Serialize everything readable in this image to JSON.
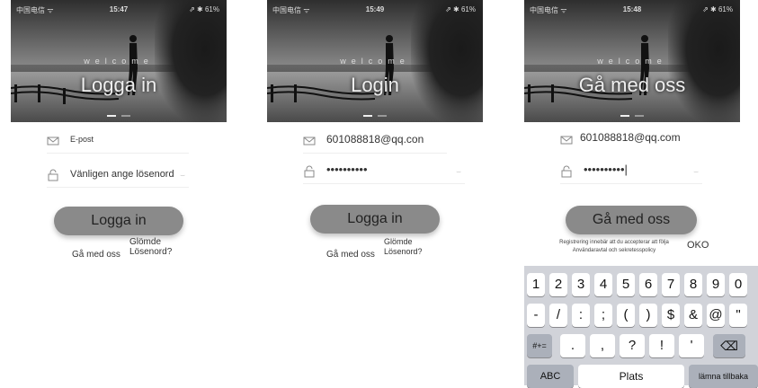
{
  "screens": [
    {
      "status": {
        "carrier": "中国电信 ᯤ",
        "time": "15:47",
        "right": "⇗ ✱ 61%"
      },
      "welcome": "welcome",
      "title": "Logga in",
      "email": {
        "text": "E-post"
      },
      "password": {
        "text": "Vänligen ange lösenord"
      },
      "button": "Logga in",
      "register_link": "Gå med oss",
      "forgot_link": "Glömde Lösenord?"
    },
    {
      "status": {
        "carrier": "中国电信 ᯤ",
        "time": "15:49",
        "right": "⇗ ✱ 61%"
      },
      "welcome": "welcome",
      "title": "Login",
      "email": {
        "text": "601088818@qq.con"
      },
      "password": {
        "text": "••••••••••"
      },
      "button": "Logga in",
      "register_link": "Gå med oss",
      "forgot_link": "Glömde Lösenord?"
    },
    {
      "status": {
        "carrier": "中国电信 ᯤ",
        "time": "15:48",
        "right": "⇗ ✱ 61%"
      },
      "welcome": "welcome",
      "title": "Gå med oss",
      "email": {
        "text": "601088818@qq.com"
      },
      "password": {
        "text": "••••••••••|"
      },
      "button": "Gå med oss",
      "terms_line1": "Registrering innebär att du accepterar att följa",
      "terms_line2": "Användaravtal och sekretesspolicy",
      "ok": "OKO"
    }
  ],
  "keyboard": {
    "row1": [
      "1",
      "2",
      "3",
      "4",
      "5",
      "6",
      "7",
      "8",
      "9",
      "0"
    ],
    "row2": [
      "-",
      "/",
      ":",
      ";",
      "(",
      ")",
      "$",
      "&",
      "@",
      "\""
    ],
    "row3_left": "#+=",
    "row3": [
      ".",
      ",",
      "?",
      "!",
      "'"
    ],
    "backspace": "⌫",
    "abc": "ABC",
    "space": "Plats",
    "return": "lämna tillbaka"
  }
}
